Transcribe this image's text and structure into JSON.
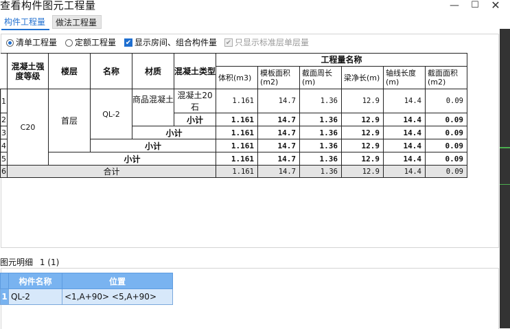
{
  "window": {
    "title": "查看构件图元工程量",
    "min": "—",
    "max": "☐",
    "close": "✕"
  },
  "tabs": [
    {
      "label": "构件工程量"
    },
    {
      "label": "做法工程量"
    }
  ],
  "options": {
    "radio_list": "清单工程量",
    "radio_quota": "定额工程量",
    "check_rooms": "显示房间、组合构件量",
    "check_std": "只显示标准层单层量"
  },
  "table": {
    "headers": {
      "grade": "混凝土强度等级",
      "floor": "楼层",
      "name": "名称",
      "material": "材质",
      "ctype": "混凝土类型",
      "group": "工程量名称",
      "cols": [
        "体积(m3)",
        "模板面积(m2)",
        "截面周长(m)",
        "梁净长(m)",
        "轴线长度(m)",
        "截面面积(m2)"
      ]
    },
    "grade": "C20",
    "floor": "首层",
    "name": "QL-2",
    "material": "商品混凝土",
    "ctype": "混凝土20石",
    "subtotal": "小计",
    "total": "合计",
    "row_index": [
      "1",
      "2",
      "3",
      "4",
      "5",
      "6"
    ],
    "values": [
      "1.161",
      "14.7",
      "1.36",
      "12.9",
      "14.4",
      "0.09"
    ]
  },
  "detail": {
    "title": "图元明细",
    "count": "1 (1)",
    "headers": [
      "构件名称",
      "位置"
    ],
    "rows": [
      {
        "idx": "1",
        "name": "QL-2",
        "position": "<1,A+90> <5,A+90>"
      }
    ]
  }
}
